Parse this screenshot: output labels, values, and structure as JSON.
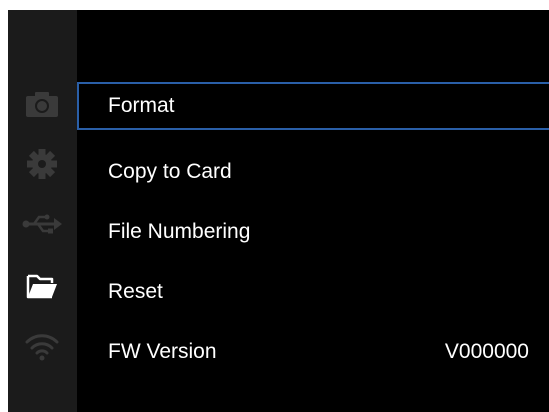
{
  "sidebar": {
    "icons": [
      {
        "name": "camera-icon",
        "active": false
      },
      {
        "name": "gear-icon",
        "active": false
      },
      {
        "name": "usb-icon",
        "active": false
      },
      {
        "name": "folder-icon",
        "active": true
      },
      {
        "name": "wifi-icon",
        "active": false
      }
    ]
  },
  "menu": {
    "items": [
      {
        "label": "Format",
        "value": "",
        "selected": true
      },
      {
        "label": "Copy to Card",
        "value": ""
      },
      {
        "label": "File Numbering",
        "value": ""
      },
      {
        "label": "Reset",
        "value": ""
      },
      {
        "label": "FW Version",
        "value": "V000000"
      }
    ]
  },
  "colors": {
    "background": "#000000",
    "sidebar": "#1b1b1b",
    "selection_border": "#2a5fa8",
    "inactive_icon": "#3a3a3a",
    "active_icon": "#ffffff",
    "text": "#ffffff"
  }
}
